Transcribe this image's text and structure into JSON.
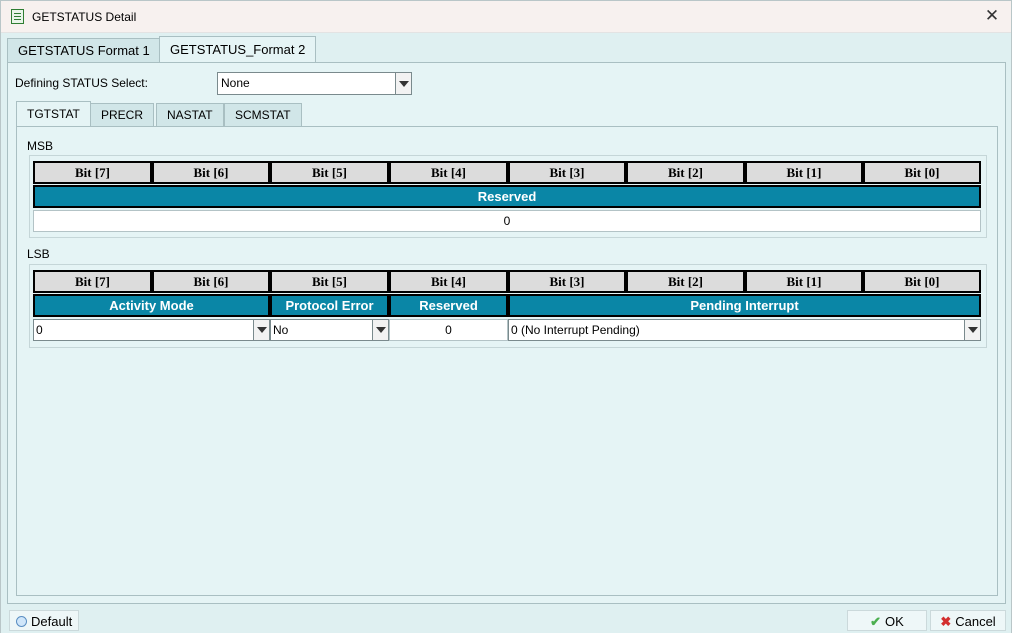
{
  "window": {
    "title": "GETSTATUS Detail"
  },
  "outer_tabs": [
    "GETSTATUS Format 1",
    "GETSTATUS_Format 2"
  ],
  "defining": {
    "label": "Defining STATUS Select:",
    "value": "None"
  },
  "inner_tabs": [
    "TGTSTAT",
    "PRECR",
    "NASTAT",
    "SCMSTAT"
  ],
  "msb": {
    "label": "MSB",
    "bits": [
      "Bit [7]",
      "Bit [6]",
      "Bit [5]",
      "Bit [4]",
      "Bit [3]",
      "Bit [2]",
      "Bit [1]",
      "Bit [0]"
    ],
    "field": "Reserved",
    "value": "0"
  },
  "lsb": {
    "label": "LSB",
    "bits": [
      "Bit [7]",
      "Bit [6]",
      "Bit [5]",
      "Bit [4]",
      "Bit [3]",
      "Bit [2]",
      "Bit [1]",
      "Bit [0]"
    ],
    "fields": [
      "Activity Mode",
      "Protocol Error",
      "Reserved",
      "Pending Interrupt"
    ],
    "values": [
      "0",
      "No",
      "0",
      "0 (No Interrupt Pending)"
    ]
  },
  "footer": {
    "default_label": "Default",
    "ok_label": "OK",
    "cancel_label": "Cancel"
  },
  "colors": {
    "field_header": "#0a86a6",
    "panel_bg": "#e5f4f5"
  },
  "icons": {
    "close": "close-icon",
    "ok": "check-icon",
    "cancel": "x-icon",
    "default": "circle-icon"
  }
}
